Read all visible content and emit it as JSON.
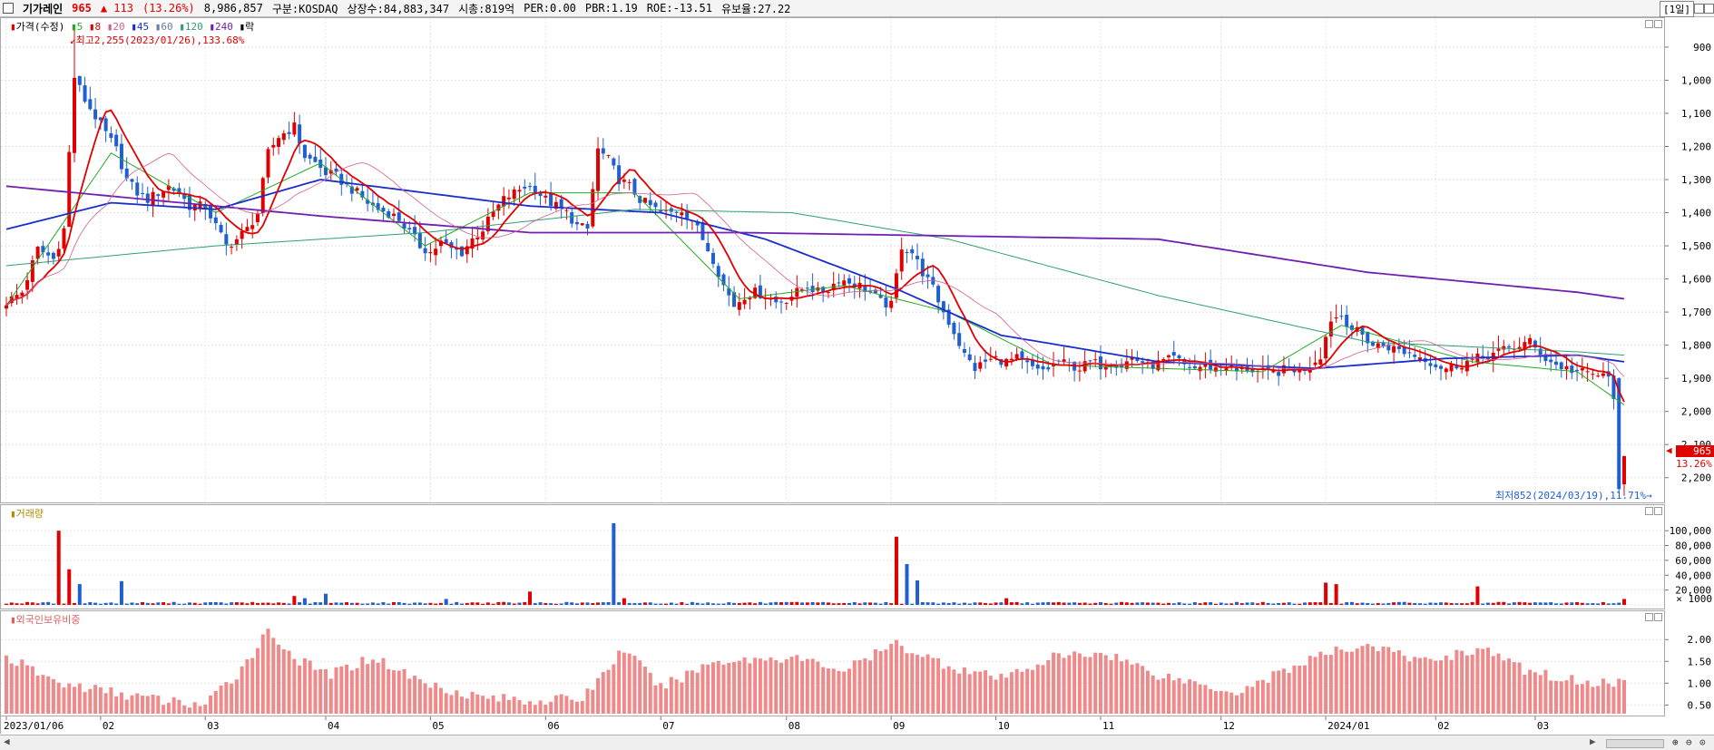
{
  "header": {
    "name": "기가레인",
    "price": "965",
    "change": "▲ 113",
    "change_pct": "(13.26%)",
    "volume": "8,986,857",
    "market": "구분:KOSDAQ",
    "shares": "상장수:84,883,347",
    "mcap": "시총:819억",
    "per": "PER:0.00",
    "pbr": "PBR:1.19",
    "roe": "ROE:-13.51",
    "float": "유보율:27.22",
    "period": "[1일]"
  },
  "price_panel": {
    "legend": [
      {
        "text": "가격(수정)",
        "color": "#000000"
      },
      {
        "text": "5",
        "color": "#22aa22"
      },
      {
        "text": "8",
        "color": "#e00000"
      },
      {
        "text": "20",
        "color": "#d06090"
      },
      {
        "text": "45",
        "color": "#1a2ecc"
      },
      {
        "text": "60",
        "color": "#6a80a0"
      },
      {
        "text": "120",
        "color": "#30a070"
      },
      {
        "text": "240",
        "color": "#7020b0"
      },
      {
        "text": "락",
        "color": "#000000"
      }
    ],
    "high_note": "최고2,255(2023/01/26),133.68%",
    "low_note": "최저852(2024/03/19),11.71%",
    "yticks": [
      "2,200",
      "2,100",
      "2,000",
      "1,900",
      "1,800",
      "1,700",
      "1,600",
      "1,500",
      "1,400",
      "1,300",
      "1,200",
      "1,100",
      "1,000",
      "900"
    ],
    "current_price_label": "965",
    "current_pct_label": "13.26%"
  },
  "volume_panel": {
    "title": "거래량",
    "yticks": [
      "100,000",
      "80,000",
      "60,000",
      "40,000",
      "20,000"
    ],
    "unit": "× 1000"
  },
  "foreign_panel": {
    "title": "외국인보유비중",
    "yticks": [
      "2.00",
      "1.50",
      "1.00",
      "0.50"
    ]
  },
  "x_labels": [
    "2023/01/06",
    "02",
    "03",
    "04",
    "05",
    "06",
    "07",
    "08",
    "09",
    "10",
    "11",
    "12",
    "2024/01",
    "02",
    "03"
  ],
  "colors": {
    "up": "#e00000",
    "down": "#1f5fd0",
    "foreign": "#f08a8a"
  },
  "chart_data": {
    "type": "candlestick",
    "title": "기가레인",
    "period": "daily",
    "ylim": [
      850,
      2260
    ],
    "ticks": [
      900,
      1000,
      1100,
      1200,
      1300,
      1400,
      1500,
      1600,
      1700,
      1800,
      1900,
      2000,
      2100,
      2200
    ],
    "x_labels": [
      "2023/01/06",
      "02",
      "03",
      "04",
      "05",
      "06",
      "07",
      "08",
      "09",
      "10",
      "11",
      "12",
      "2024/01",
      "02",
      "03"
    ],
    "month_start_index": [
      0,
      18,
      38,
      61,
      81,
      103,
      125,
      149,
      169,
      189,
      209,
      232,
      252,
      273,
      292
    ],
    "close_path": [
      [
        0,
        1430
      ],
      [
        3,
        1460
      ],
      [
        6,
        1590
      ],
      [
        9,
        1560
      ],
      [
        11,
        1650
      ],
      [
        13,
        2110
      ],
      [
        15,
        2040
      ],
      [
        17,
        1990
      ],
      [
        19,
        1940
      ],
      [
        21,
        1890
      ],
      [
        23,
        1800
      ],
      [
        25,
        1760
      ],
      [
        27,
        1740
      ],
      [
        29,
        1760
      ],
      [
        31,
        1780
      ],
      [
        33,
        1760
      ],
      [
        35,
        1720
      ],
      [
        38,
        1720
      ],
      [
        40,
        1660
      ],
      [
        42,
        1600
      ],
      [
        44,
        1620
      ],
      [
        46,
        1650
      ],
      [
        48,
        1700
      ],
      [
        50,
        1880
      ],
      [
        52,
        1930
      ],
      [
        55,
        1960
      ],
      [
        57,
        1870
      ],
      [
        59,
        1850
      ],
      [
        61,
        1820
      ],
      [
        63,
        1810
      ],
      [
        65,
        1780
      ],
      [
        67,
        1760
      ],
      [
        69,
        1730
      ],
      [
        71,
        1710
      ],
      [
        73,
        1700
      ],
      [
        75,
        1680
      ],
      [
        77,
        1640
      ],
      [
        79,
        1600
      ],
      [
        81,
        1580
      ],
      [
        83,
        1610
      ],
      [
        85,
        1590
      ],
      [
        87,
        1580
      ],
      [
        89,
        1620
      ],
      [
        91,
        1650
      ],
      [
        93,
        1700
      ],
      [
        95,
        1740
      ],
      [
        97,
        1760
      ],
      [
        99,
        1780
      ],
      [
        101,
        1770
      ],
      [
        103,
        1740
      ],
      [
        105,
        1720
      ],
      [
        107,
        1700
      ],
      [
        109,
        1660
      ],
      [
        111,
        1650
      ],
      [
        113,
        1890
      ],
      [
        115,
        1860
      ],
      [
        117,
        1800
      ],
      [
        119,
        1780
      ],
      [
        121,
        1740
      ],
      [
        123,
        1720
      ],
      [
        125,
        1700
      ],
      [
        127,
        1700
      ],
      [
        129,
        1710
      ],
      [
        131,
        1680
      ],
      [
        133,
        1620
      ],
      [
        135,
        1560
      ],
      [
        137,
        1480
      ],
      [
        139,
        1420
      ],
      [
        141,
        1450
      ],
      [
        143,
        1460
      ],
      [
        145,
        1450
      ],
      [
        147,
        1430
      ],
      [
        149,
        1440
      ],
      [
        151,
        1460
      ],
      [
        153,
        1480
      ],
      [
        155,
        1460
      ],
      [
        157,
        1470
      ],
      [
        159,
        1500
      ],
      [
        161,
        1490
      ],
      [
        163,
        1480
      ],
      [
        165,
        1460
      ],
      [
        167,
        1430
      ],
      [
        169,
        1420
      ],
      [
        171,
        1600
      ],
      [
        173,
        1580
      ],
      [
        175,
        1520
      ],
      [
        177,
        1470
      ],
      [
        179,
        1400
      ],
      [
        181,
        1340
      ],
      [
        183,
        1270
      ],
      [
        185,
        1230
      ],
      [
        187,
        1250
      ],
      [
        189,
        1260
      ],
      [
        191,
        1250
      ],
      [
        193,
        1260
      ],
      [
        195,
        1240
      ],
      [
        197,
        1220
      ],
      [
        199,
        1230
      ],
      [
        201,
        1250
      ],
      [
        203,
        1240
      ],
      [
        205,
        1230
      ],
      [
        207,
        1250
      ],
      [
        209,
        1240
      ],
      [
        211,
        1250
      ],
      [
        213,
        1240
      ],
      [
        215,
        1260
      ],
      [
        217,
        1250
      ],
      [
        219,
        1240
      ],
      [
        221,
        1250
      ],
      [
        223,
        1260
      ],
      [
        225,
        1240
      ],
      [
        227,
        1230
      ],
      [
        229,
        1240
      ],
      [
        231,
        1230
      ],
      [
        233,
        1240
      ],
      [
        235,
        1220
      ],
      [
        237,
        1230
      ],
      [
        239,
        1220
      ],
      [
        241,
        1215
      ],
      [
        243,
        1220
      ],
      [
        245,
        1230
      ],
      [
        247,
        1225
      ],
      [
        249,
        1240
      ],
      [
        251,
        1270
      ],
      [
        253,
        1380
      ],
      [
        255,
        1390
      ],
      [
        257,
        1350
      ],
      [
        259,
        1330
      ],
      [
        261,
        1300
      ],
      [
        263,
        1300
      ],
      [
        265,
        1290
      ],
      [
        267,
        1280
      ],
      [
        269,
        1270
      ],
      [
        271,
        1260
      ],
      [
        273,
        1240
      ],
      [
        275,
        1230
      ],
      [
        277,
        1240
      ],
      [
        279,
        1250
      ],
      [
        281,
        1260
      ],
      [
        283,
        1270
      ],
      [
        285,
        1280
      ],
      [
        287,
        1290
      ],
      [
        289,
        1300
      ],
      [
        291,
        1310
      ],
      [
        292,
        1290
      ],
      [
        294,
        1260
      ],
      [
        296,
        1240
      ],
      [
        298,
        1230
      ],
      [
        300,
        1220
      ],
      [
        302,
        1215
      ],
      [
        304,
        1210
      ],
      [
        306,
        1200
      ],
      [
        307,
        1150
      ],
      [
        308,
        852
      ],
      [
        309,
        965
      ]
    ],
    "high": {
      "value": 2255,
      "date": "2023/01/26",
      "pct": "133.68%"
    },
    "low": {
      "value": 852,
      "date": "2024/03/19",
      "pct": "11.71%"
    },
    "last": {
      "close": 965,
      "change": 113,
      "change_pct": "13.26%",
      "volume": 8986857
    },
    "moving_averages": [
      "5",
      "8",
      "20",
      "45",
      "60",
      "120",
      "240"
    ],
    "ma_anchor": {
      "ma5": [
        [
          0,
          1420
        ],
        [
          20,
          1880
        ],
        [
          40,
          1700
        ],
        [
          60,
          1850
        ],
        [
          80,
          1600
        ],
        [
          100,
          1760
        ],
        [
          120,
          1760
        ],
        [
          140,
          1440
        ],
        [
          160,
          1480
        ],
        [
          180,
          1400
        ],
        [
          200,
          1240
        ],
        [
          240,
          1220
        ],
        [
          255,
          1360
        ],
        [
          280,
          1250
        ],
        [
          300,
          1220
        ],
        [
          309,
          1120
        ]
      ],
      "ma45": [
        [
          0,
          1650
        ],
        [
          20,
          1730
        ],
        [
          40,
          1710
        ],
        [
          60,
          1800
        ],
        [
          80,
          1760
        ],
        [
          100,
          1720
        ],
        [
          125,
          1700
        ],
        [
          145,
          1620
        ],
        [
          170,
          1470
        ],
        [
          190,
          1330
        ],
        [
          220,
          1250
        ],
        [
          250,
          1230
        ],
        [
          275,
          1260
        ],
        [
          300,
          1270
        ],
        [
          309,
          1250
        ]
      ],
      "ma120": [
        [
          0,
          1540
        ],
        [
          40,
          1600
        ],
        [
          80,
          1640
        ],
        [
          120,
          1710
        ],
        [
          150,
          1700
        ],
        [
          180,
          1620
        ],
        [
          220,
          1450
        ],
        [
          260,
          1310
        ],
        [
          300,
          1280
        ],
        [
          309,
          1270
        ]
      ],
      "ma240": [
        [
          0,
          1780
        ],
        [
          60,
          1690
        ],
        [
          100,
          1640
        ],
        [
          140,
          1640
        ],
        [
          180,
          1630
        ],
        [
          220,
          1620
        ],
        [
          260,
          1520
        ],
        [
          300,
          1460
        ],
        [
          309,
          1440
        ]
      ]
    },
    "volume_unit": "× 1000",
    "volume_ylim": [
      0,
      110000
    ],
    "volume_spikes": [
      [
        10,
        100000
      ],
      [
        12,
        48000
      ],
      [
        14,
        28000
      ],
      [
        22,
        32000
      ],
      [
        55,
        12000
      ],
      [
        57,
        9000
      ],
      [
        61,
        15000
      ],
      [
        84,
        8000
      ],
      [
        100,
        18000
      ],
      [
        116,
        110000
      ],
      [
        118,
        9000
      ],
      [
        170,
        92000
      ],
      [
        172,
        55000
      ],
      [
        174,
        33000
      ],
      [
        191,
        9000
      ],
      [
        252,
        30000
      ],
      [
        254,
        28000
      ],
      [
        281,
        25000
      ],
      [
        309,
        8000
      ]
    ],
    "foreign_ylim": [
      0.3,
      2.4
    ],
    "foreign_anchor": [
      [
        0,
        1.6
      ],
      [
        10,
        1.0
      ],
      [
        20,
        0.8
      ],
      [
        30,
        0.6
      ],
      [
        38,
        0.5
      ],
      [
        44,
        1.2
      ],
      [
        50,
        2.2
      ],
      [
        56,
        1.5
      ],
      [
        62,
        1.2
      ],
      [
        70,
        1.6
      ],
      [
        80,
        1.0
      ],
      [
        90,
        0.7
      ],
      [
        100,
        0.6
      ],
      [
        110,
        0.65
      ],
      [
        118,
        1.8
      ],
      [
        125,
        0.9
      ],
      [
        135,
        1.5
      ],
      [
        150,
        1.6
      ],
      [
        160,
        1.3
      ],
      [
        170,
        1.9
      ],
      [
        180,
        1.4
      ],
      [
        190,
        1.1
      ],
      [
        200,
        1.6
      ],
      [
        210,
        1.7
      ],
      [
        220,
        1.2
      ],
      [
        235,
        0.8
      ],
      [
        250,
        1.6
      ],
      [
        260,
        1.9
      ],
      [
        270,
        1.5
      ],
      [
        282,
        1.8
      ],
      [
        290,
        1.3
      ],
      [
        300,
        1.05
      ],
      [
        309,
        1.0
      ]
    ]
  }
}
